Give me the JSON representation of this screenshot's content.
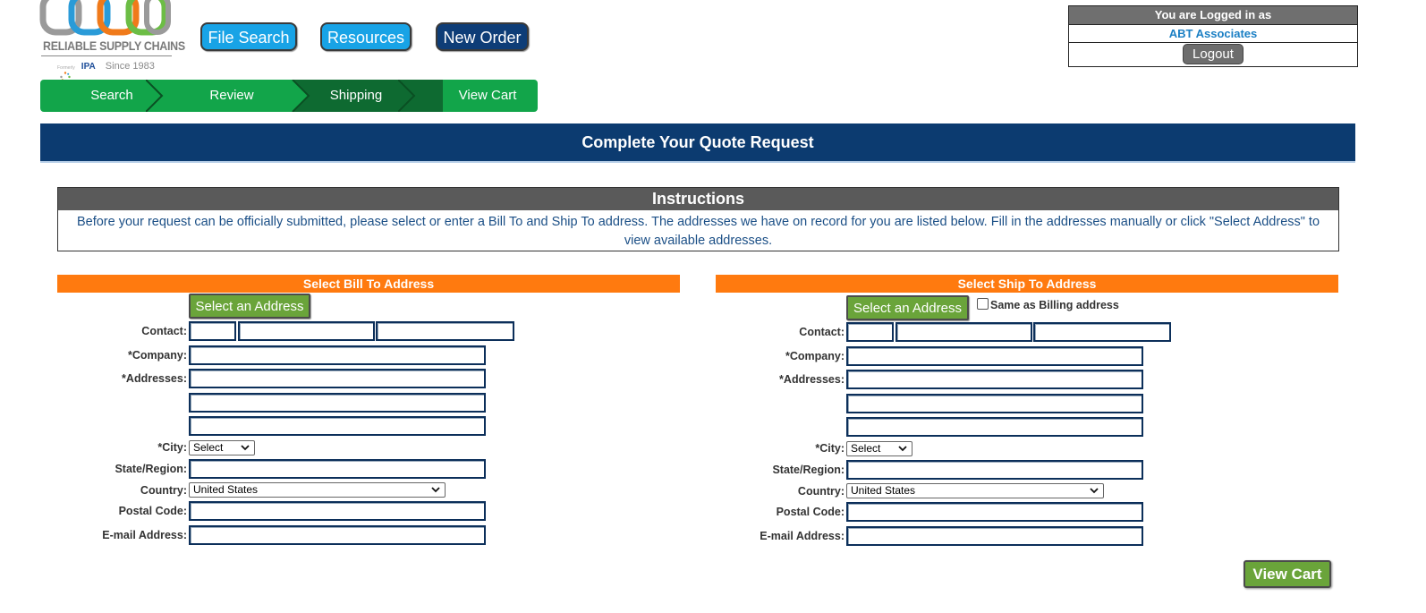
{
  "logo": {
    "name": "RELIABLE SUPPLY CHAINS",
    "formerly": "Formerly",
    "ipa": "IPA",
    "since": "Since 1983",
    "colors": [
      "#f07a1a",
      "#2a9bd8",
      "#6cbd45",
      "#9a9a9a"
    ]
  },
  "top_nav": {
    "file_search": "File Search",
    "resources": "Resources",
    "new_order": "New Order"
  },
  "login": {
    "header": "You are Logged in as",
    "user": "ABT Associates",
    "logout": "Logout"
  },
  "steps": [
    {
      "label": "Search",
      "active": false
    },
    {
      "label": "Review",
      "active": false
    },
    {
      "label": "Shipping",
      "active": true
    },
    {
      "label": "View Cart",
      "active": false
    }
  ],
  "banner": {
    "title": "Complete Your Quote Request"
  },
  "instructions": {
    "title": "Instructions",
    "text": "Before your request can be officially submitted, please select or enter a Bill To and Ship To address. The addresses we have on record for you are listed below. Fill in the addresses manually or click \"Select Address\" to view available addresses."
  },
  "bill_to": {
    "header": "Select Bill To Address",
    "select_button": "Select an Address",
    "labels": {
      "contact": "Contact:",
      "company": "*Company:",
      "addresses": "*Addresses:",
      "city": "*City:",
      "state": "State/Region:",
      "country": "Country:",
      "postal": "Postal Code:",
      "email": "E-mail Address:"
    },
    "city_value": "Select",
    "country_value": "United States"
  },
  "ship_to": {
    "header": "Select Ship To Address",
    "select_button": "Select an Address",
    "same_as_billing": "Same as Billing address",
    "labels": {
      "contact": "Contact:",
      "company": "*Company:",
      "addresses": "*Addresses:",
      "city": "*City:",
      "state": "State/Region:",
      "country": "Country:",
      "postal": "Postal Code:",
      "email": "E-mail Address:"
    },
    "city_value": "Select",
    "country_value": "United States"
  },
  "footer": {
    "view_cart": "View Cart"
  },
  "colors": {
    "navy": "#0c3b70",
    "green": "#12a54a",
    "green_dark": "#0e6a31",
    "orange": "#ff7a0f",
    "button_green": "#6aa43a",
    "button_blue": "#18a3e6"
  }
}
